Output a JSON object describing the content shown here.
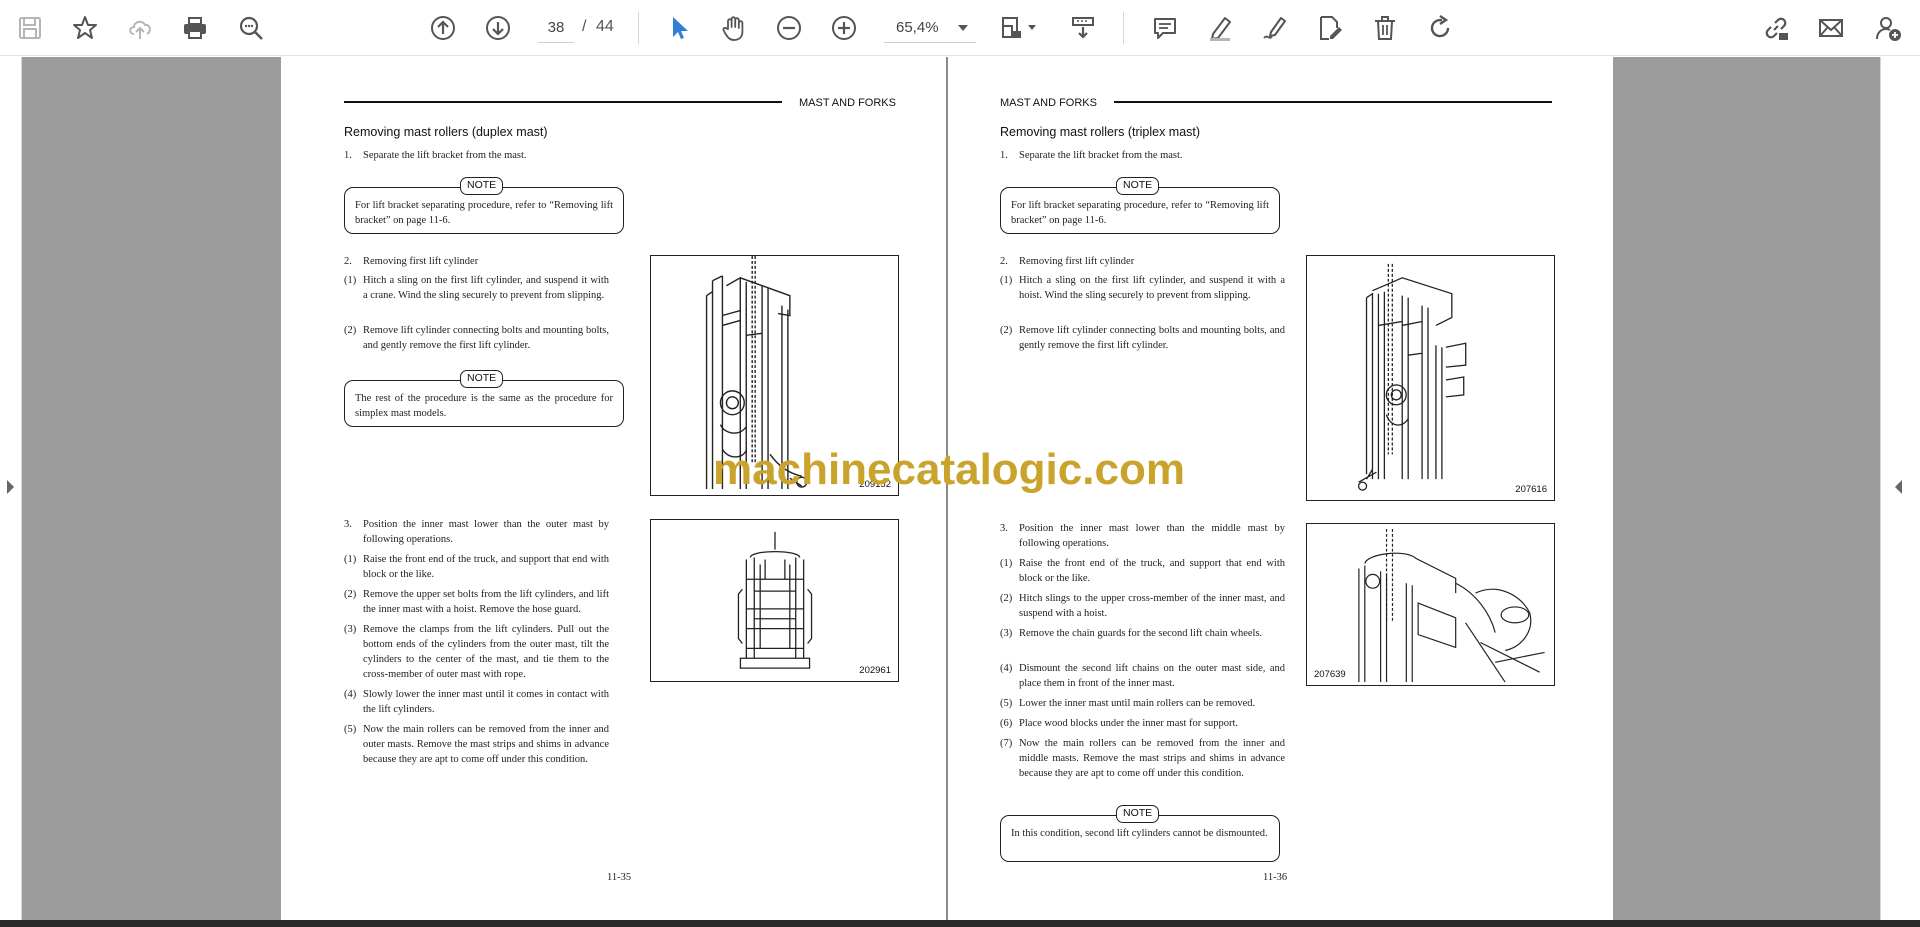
{
  "toolbar": {
    "current_page": "38",
    "page_separator": "/",
    "total_pages": "44",
    "zoom": "65,4%"
  },
  "icons": [
    "save-icon",
    "bookmark-star-icon",
    "cloud-upload-icon",
    "print-icon",
    "zoom-search-icon",
    "page-up-icon",
    "page-down-icon",
    "select-cursor-icon",
    "hand-pan-icon",
    "zoom-out-icon",
    "zoom-in-icon",
    "page-fit-icon",
    "scroll-mode-icon",
    "comment-icon",
    "highlight-pen-icon",
    "draw-pen-icon",
    "edit-document-icon",
    "delete-icon",
    "rotate-icon",
    "share-link-icon",
    "email-icon",
    "add-user-icon"
  ],
  "accent_color": "#2f7fd6",
  "watermark": "machinecatalogic.com",
  "left_page": {
    "header": "MAST AND FORKS",
    "section_title": "Removing mast rollers (duplex mast)",
    "step1": {
      "num": "1.",
      "text": "Separate the lift bracket from the mast."
    },
    "note1": {
      "tag": "NOTE",
      "text": "For lift bracket separating procedure, refer to “Removing lift bracket” on page 11-6."
    },
    "step2": {
      "num": "2.",
      "text": "Removing first lift cylinder"
    },
    "step2_1": {
      "num": "(1)",
      "text": "Hitch a sling on the first lift cylinder, and suspend it with a crane. Wind the sling securely to prevent from slipping."
    },
    "step2_2": {
      "num": "(2)",
      "text": "Remove lift cylinder connecting bolts and mounting bolts, and gently remove the first lift cylinder."
    },
    "note2": {
      "tag": "NOTE",
      "text": "The rest of the procedure is the same as the procedure for simplex mast models."
    },
    "fig1_id": "209152",
    "step3": {
      "num": "3.",
      "text": "Position the inner mast lower than the outer mast by following operations."
    },
    "step3_1": {
      "num": "(1)",
      "text": "Raise the front end of the truck, and support that end with block or the like."
    },
    "step3_2": {
      "num": "(2)",
      "text": "Remove the upper set bolts from the lift cylinders, and lift the inner mast with a hoist. Remove the hose guard."
    },
    "step3_3": {
      "num": "(3)",
      "text": "Remove the clamps from the lift cylinders. Pull out the bottom ends of the cylinders from the outer mast, tilt the cylinders to the center of the mast, and tie them to the cross-member of outer mast with rope."
    },
    "step3_4": {
      "num": "(4)",
      "text": "Slowly lower the inner mast until it comes in contact with the lift cylinders."
    },
    "step3_5": {
      "num": "(5)",
      "text": "Now the main rollers can be removed from the inner and outer masts. Remove the mast strips and shims in advance because they are apt to come off under this condition."
    },
    "fig2_id": "202961",
    "page_number": "11-35"
  },
  "right_page": {
    "header": "MAST AND FORKS",
    "section_title": "Removing mast rollers (triplex mast)",
    "step1": {
      "num": "1.",
      "text": "Separate the lift bracket from the mast."
    },
    "note1": {
      "tag": "NOTE",
      "text": "For lift bracket separating procedure, refer to “Removing lift bracket” on page 11-6."
    },
    "step2": {
      "num": "2.",
      "text": "Removing first lift cylinder"
    },
    "step2_1": {
      "num": "(1)",
      "text": "Hitch a sling on the first lift cylinder, and suspend it with a hoist. Wind the sling securely to prevent from slipping."
    },
    "step2_2": {
      "num": "(2)",
      "text": "Remove lift cylinder connecting bolts and mounting bolts, and gently remove the first lift cylinder."
    },
    "fig1_id": "207616",
    "step3": {
      "num": "3.",
      "text": "Position the inner mast lower than the middle mast by following operations."
    },
    "step3_1": {
      "num": "(1)",
      "text": "Raise the front end of the truck, and support that end with block or the like."
    },
    "step3_2": {
      "num": "(2)",
      "text": "Hitch slings to the upper cross-member of the inner mast, and suspend with a hoist."
    },
    "step3_3": {
      "num": "(3)",
      "text": "Remove the chain guards for the second lift chain wheels."
    },
    "step3_4": {
      "num": "(4)",
      "text": "Dismount the second lift chains on the outer mast side, and place them in front of the inner mast."
    },
    "step3_5": {
      "num": "(5)",
      "text": "Lower the inner mast until main rollers can be removed."
    },
    "step3_6": {
      "num": "(6)",
      "text": "Place wood blocks under the inner mast for support."
    },
    "step3_7": {
      "num": "(7)",
      "text": "Now the main rollers can be removed from the inner and middle masts. Remove the mast strips and shims in advance because they are apt to come off under this condition."
    },
    "note2": {
      "tag": "NOTE",
      "text": "In this condition, second lift cylinders cannot be dismounted."
    },
    "fig2_id": "207639",
    "page_number": "11-36"
  }
}
